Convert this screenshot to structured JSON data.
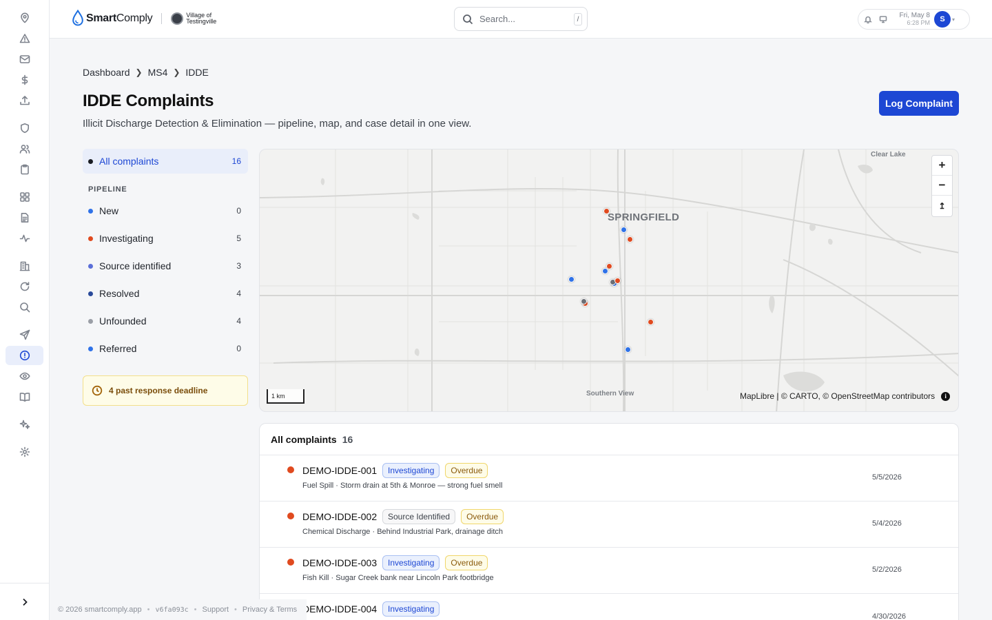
{
  "header": {
    "brand_bold": "Smart",
    "brand_light": "Comply",
    "village_line1": "Village of",
    "village_line2": "Testingville",
    "search_placeholder": "Search...",
    "search_shortcut": "/",
    "date": "Fri, May 8",
    "time": "6:28 PM",
    "avatar_initial": "S"
  },
  "rail": {
    "icons": [
      "map-pin-icon",
      "alert-triangle-icon",
      "mail-icon",
      "dollar-icon",
      "upload-icon",
      "shield-icon",
      "users-icon",
      "clipboard-icon",
      "grid-icon",
      "document-icon",
      "activity-icon",
      "building-icon",
      "refresh-icon",
      "search-icon",
      "send-icon",
      "alert-circle-icon",
      "eye-icon",
      "book-icon",
      "sparkles-icon",
      "gear-icon"
    ],
    "active_icon": "alert-circle-icon",
    "expand_icon": "chevron-right-icon"
  },
  "breadcrumb": [
    "Dashboard",
    "MS4",
    "IDDE"
  ],
  "page": {
    "title": "IDDE Complaints",
    "subtitle": "Illicit Discharge Detection & Elimination — pipeline, map, and case detail in one view.",
    "primary_action": "Log Complaint"
  },
  "filters": {
    "all": {
      "label": "All complaints",
      "count": "16",
      "color": "#1a1d23"
    },
    "pipeline_label": "PIPELINE",
    "pipeline": [
      {
        "label": "New",
        "count": "0",
        "color": "#2f72e8"
      },
      {
        "label": "Investigating",
        "count": "5",
        "color": "#e04a1f"
      },
      {
        "label": "Source identified",
        "count": "3",
        "color": "#5b6fd8"
      },
      {
        "label": "Resolved",
        "count": "4",
        "color": "#2a4a9a"
      },
      {
        "label": "Unfounded",
        "count": "4",
        "color": "#9a9ea6"
      },
      {
        "label": "Referred",
        "count": "0",
        "color": "#2f72e8"
      }
    ],
    "deadline_text": "4 past response deadline"
  },
  "map": {
    "city_label": "SPRINGFIELD",
    "places": [
      "Clear Lake",
      "Southern View"
    ],
    "scale_label": "1 km",
    "attribution": "MapLibre | © CARTO, © OpenStreetMap contributors",
    "info_glyph": "i",
    "zoom_in": "+",
    "zoom_out": "−",
    "reset_bearing": "↥"
  },
  "list": {
    "title": "All complaints",
    "count": "16",
    "rows": [
      {
        "id": "DEMO-IDDE-001",
        "status": "Investigating",
        "status_kind": "inv",
        "overdue": "Overdue",
        "desc": "Fuel Spill · Storm drain at 5th & Monroe — strong fuel smell",
        "date": "5/5/2026",
        "dot": "#e04a1f"
      },
      {
        "id": "DEMO-IDDE-002",
        "status": "Source Identified",
        "status_kind": "src",
        "overdue": "Overdue",
        "desc": "Chemical Discharge · Behind Industrial Park, drainage ditch",
        "date": "5/4/2026",
        "dot": "#e04a1f"
      },
      {
        "id": "DEMO-IDDE-003",
        "status": "Investigating",
        "status_kind": "inv",
        "overdue": "Overdue",
        "desc": "Fish Kill · Sugar Creek bank near Lincoln Park footbridge",
        "date": "5/2/2026",
        "dot": "#e04a1f"
      },
      {
        "id": "DEMO-IDDE-004",
        "status": "Investigating",
        "status_kind": "inv",
        "overdue": "",
        "desc": "",
        "date": "4/30/2026",
        "dot": "#e04a1f"
      }
    ]
  },
  "footer": {
    "copyright": "© 2026 smartcomply.app",
    "version": "v6fa093c",
    "support": "Support",
    "privacy": "Privacy & Terms"
  }
}
